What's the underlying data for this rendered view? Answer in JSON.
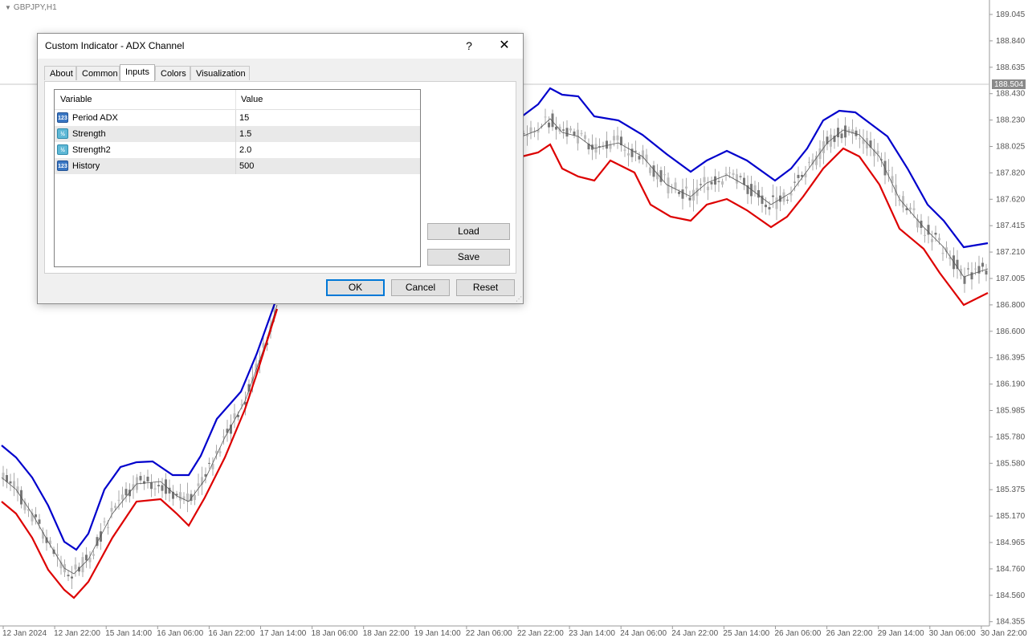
{
  "chart": {
    "symbol": "GBPJPY,H1",
    "current_price": "188.504",
    "price_labels": [
      "189.045",
      "188.840",
      "188.635",
      "188.430",
      "188.230",
      "188.025",
      "187.820",
      "187.620",
      "187.415",
      "187.210",
      "187.005",
      "186.800",
      "186.600",
      "186.395",
      "186.190",
      "185.985",
      "185.780",
      "185.580",
      "185.375",
      "185.170",
      "184.965",
      "184.760",
      "184.560",
      "184.355"
    ],
    "time_labels": [
      "12 Jan 2024",
      "12 Jan 22:00",
      "15 Jan 14:00",
      "16 Jan 06:00",
      "16 Jan 22:00",
      "17 Jan 14:00",
      "18 Jan 06:00",
      "18 Jan 22:00",
      "19 Jan 14:00",
      "22 Jan 06:00",
      "22 Jan 22:00",
      "23 Jan 14:00",
      "24 Jan 06:00",
      "24 Jan 22:00",
      "25 Jan 14:00",
      "26 Jan 06:00",
      "26 Jan 22:00",
      "29 Jan 14:00",
      "30 Jan 06:00",
      "30 Jan 22:00"
    ],
    "colors": {
      "upper": "#0000cc",
      "lower": "#dd0000",
      "middle": "#555555",
      "candle": "#808080"
    }
  },
  "dialog": {
    "title": "Custom Indicator - ADX Channel",
    "help_label": "?",
    "close_label": "✕",
    "tabs": [
      {
        "label": "About"
      },
      {
        "label": "Common"
      },
      {
        "label": "Inputs"
      },
      {
        "label": "Colors"
      },
      {
        "label": "Visualization"
      }
    ],
    "active_tab": "Inputs",
    "grid": {
      "header_variable": "Variable",
      "header_value": "Value",
      "rows": [
        {
          "icon": "int",
          "icon_text": "123",
          "name": "Period ADX",
          "value": "15"
        },
        {
          "icon": "dbl",
          "icon_text": "½",
          "name": "Strength",
          "value": "1.5"
        },
        {
          "icon": "dbl",
          "icon_text": "½",
          "name": "Strength2",
          "value": "2.0"
        },
        {
          "icon": "int",
          "icon_text": "123",
          "name": "History",
          "value": "500"
        }
      ]
    },
    "load_label": "Load",
    "save_label": "Save",
    "ok_label": "OK",
    "cancel_label": "Cancel",
    "reset_label": "Reset"
  }
}
